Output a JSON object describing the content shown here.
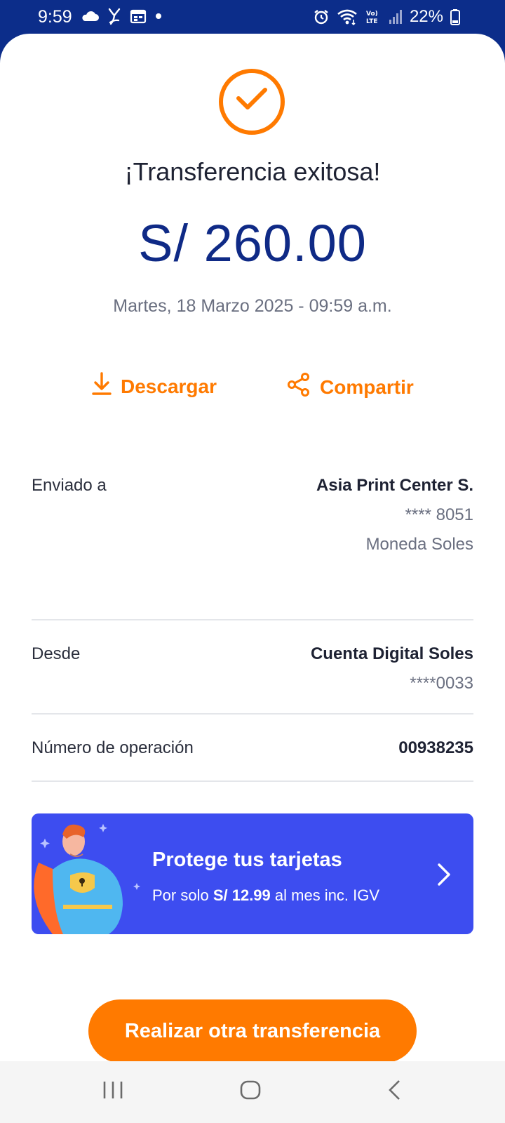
{
  "status_bar": {
    "time": "9:59",
    "battery": "22%",
    "left_icons": [
      "cloud-icon",
      "y-app-icon",
      "calendar-icon",
      "dot-icon"
    ],
    "right_icons": [
      "alarm-icon",
      "wifi-icon",
      "volte-icon",
      "signal-icon",
      "battery-icon"
    ]
  },
  "receipt": {
    "title": "¡Transferencia exitosa!",
    "amount": "S/ 260.00",
    "datetime": "Martes, 18 Marzo 2025 - 09:59 a.m."
  },
  "actions": {
    "download_label": "Descargar",
    "share_label": "Compartir"
  },
  "details": {
    "sent_to": {
      "label": "Enviado a",
      "name": "Asia Print Center S.",
      "account": "**** 8051",
      "currency": "Moneda Soles"
    },
    "from": {
      "label": "Desde",
      "account_name": "Cuenta Digital Soles",
      "account": "****0033"
    },
    "operation": {
      "label": "Número de operación",
      "number": "00938235"
    }
  },
  "banner": {
    "title": "Protege tus tarjetas",
    "sub_prefix": "Por solo ",
    "sub_price": "S/ 12.99",
    "sub_suffix": " al mes inc. IGV"
  },
  "cta": {
    "label": "Realizar otra transferencia"
  },
  "colors": {
    "brand_blue": "#0c2d8a",
    "accent_orange": "#ff7a00",
    "banner_blue": "#3d4df0"
  }
}
